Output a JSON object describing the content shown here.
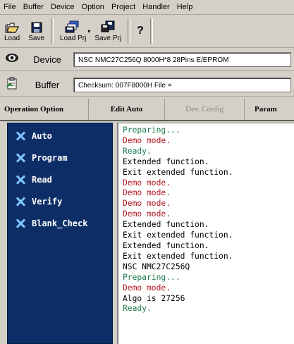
{
  "menu": [
    "File",
    "Buffer",
    "Device",
    "Option",
    "Project",
    "Handler",
    "Help"
  ],
  "toolbar": {
    "load": "Load",
    "save": "Save",
    "load_prj": "Load Prj",
    "save_prj": "Save Prj"
  },
  "device": {
    "label": "Device",
    "value": "NSC NMC27C256Q  8000H*8  28Pins  E/EPROM"
  },
  "buffer": {
    "label": "Buffer",
    "value": "Checksum: 007F8000H    File ="
  },
  "tabs": [
    "Operation Option",
    "Edit Auto",
    "Dev. Config",
    "Param"
  ],
  "sidebar": [
    "Auto",
    "Program",
    "Read",
    "Verify",
    "Blank_Check"
  ],
  "log": [
    {
      "text": "Preparing...",
      "color": "#1f7a4d"
    },
    {
      "text": "Demo mode.",
      "color": "#b0141e"
    },
    {
      "text": "Ready.",
      "color": "#1f7a4d"
    },
    {
      "text": "Extended function.",
      "color": "#000000"
    },
    {
      "text": "Exit extended function.",
      "color": "#000000"
    },
    {
      "text": "Demo mode.",
      "color": "#b0141e"
    },
    {
      "text": "Demo mode.",
      "color": "#b0141e"
    },
    {
      "text": "Demo mode.",
      "color": "#b0141e"
    },
    {
      "text": "Demo mode.",
      "color": "#b0141e"
    },
    {
      "text": "Extended function.",
      "color": "#000000"
    },
    {
      "text": "Exit extended function.",
      "color": "#000000"
    },
    {
      "text": "Extended function.",
      "color": "#000000"
    },
    {
      "text": "Exit extended function.",
      "color": "#000000"
    },
    {
      "text": "NSC NMC27C256Q",
      "color": "#000000"
    },
    {
      "text": "Preparing...",
      "color": "#1f7a4d"
    },
    {
      "text": "Demo mode.",
      "color": "#b0141e"
    },
    {
      "text": "Algo is 27256",
      "color": "#000000"
    },
    {
      "text": "Ready.",
      "color": "#1f7a4d"
    }
  ]
}
